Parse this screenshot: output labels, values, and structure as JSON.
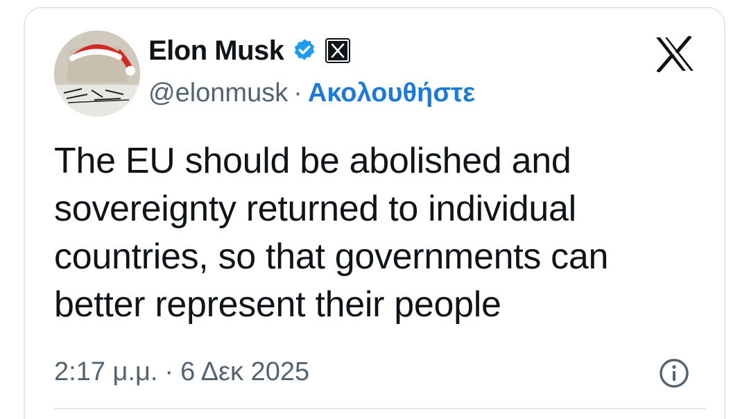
{
  "author": {
    "display_name": "Elon Musk",
    "handle": "@elonmusk",
    "separator": "·",
    "follow_label": "Ακολουθήστε",
    "avatar_icon": "avatar-santa-hat-icon",
    "verified_icon": "verified-badge-icon",
    "affiliation_icon": "x-affiliate-badge-icon"
  },
  "platform_logo_icon": "x-logo-icon",
  "tweet": {
    "text": "The EU should be abolished and sovereignty returned to individual countries, so that governments can better represent their people"
  },
  "meta": {
    "time": "2:17 μ.μ.",
    "separator": "·",
    "date": "6 Δεκ 2025",
    "info_icon": "info-icon"
  },
  "colors": {
    "text": "#0f1419",
    "secondary": "#536471",
    "link": "#1d7ad6",
    "verified": "#1d9bf0",
    "border": "#e3e7ea"
  }
}
